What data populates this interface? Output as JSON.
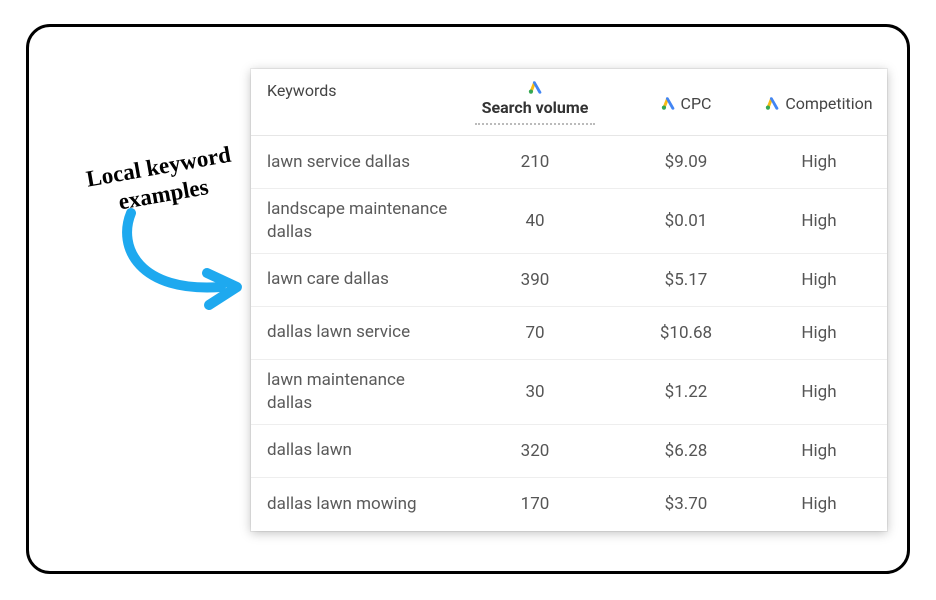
{
  "annotation": {
    "line1": "Local keyword",
    "line2": "examples"
  },
  "table": {
    "headers": {
      "keywords": "Keywords",
      "search_volume": "Search volume",
      "cpc": "CPC",
      "competition": "Competition"
    },
    "rows": [
      {
        "keyword": "lawn service dallas",
        "volume": "210",
        "cpc": "$9.09",
        "competition": "High"
      },
      {
        "keyword": "landscape maintenance dallas",
        "volume": "40",
        "cpc": "$0.01",
        "competition": "High"
      },
      {
        "keyword": "lawn care dallas",
        "volume": "390",
        "cpc": "$5.17",
        "competition": "High"
      },
      {
        "keyword": "dallas lawn service",
        "volume": "70",
        "cpc": "$10.68",
        "competition": "High"
      },
      {
        "keyword": "lawn maintenance dallas",
        "volume": "30",
        "cpc": "$1.22",
        "competition": "High"
      },
      {
        "keyword": "dallas lawn",
        "volume": "320",
        "cpc": "$6.28",
        "competition": "High"
      },
      {
        "keyword": "dallas lawn mowing",
        "volume": "170",
        "cpc": "$3.70",
        "competition": "High"
      }
    ]
  }
}
